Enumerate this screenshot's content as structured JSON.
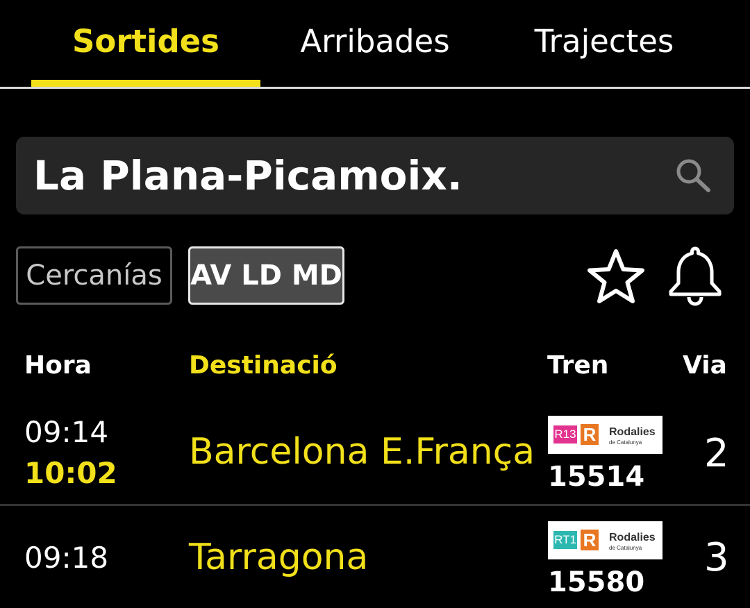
{
  "tabs": {
    "departures": "Sortides",
    "arrivals": "Arribades",
    "routes": "Trajectes",
    "active": "Sortides"
  },
  "search": {
    "value": "La Plana-Picamoix.",
    "icon": "search-icon"
  },
  "filters": {
    "cercanias": "Cercanías",
    "av_ld_md": "AV LD MD",
    "selected": "AV LD MD"
  },
  "icons": {
    "favorite": "star-icon",
    "notifications": "bell-icon"
  },
  "table": {
    "headers": {
      "time": "Hora",
      "destination": "Destinació",
      "train": "Tren",
      "platform": "Via"
    },
    "rows": [
      {
        "scheduled": "09:14",
        "actual": "10:02",
        "destination": "Barcelona E.França",
        "line": "R13",
        "line_color": "#e2338f",
        "brand": "Rodalies",
        "brand_sub": "de Catalunya",
        "train_number": "15514",
        "platform": "2"
      },
      {
        "scheduled": "09:18",
        "destination": "Tarragona",
        "line": "RT1",
        "line_color": "#2cb8b0",
        "brand": "Rodalies",
        "brand_sub": "de Catalunya",
        "train_number": "15580",
        "platform": "3"
      }
    ]
  },
  "colors": {
    "accent": "#f2e01a",
    "background": "#000000",
    "search_bg": "#262626",
    "rodalies_orange": "#e87722"
  }
}
